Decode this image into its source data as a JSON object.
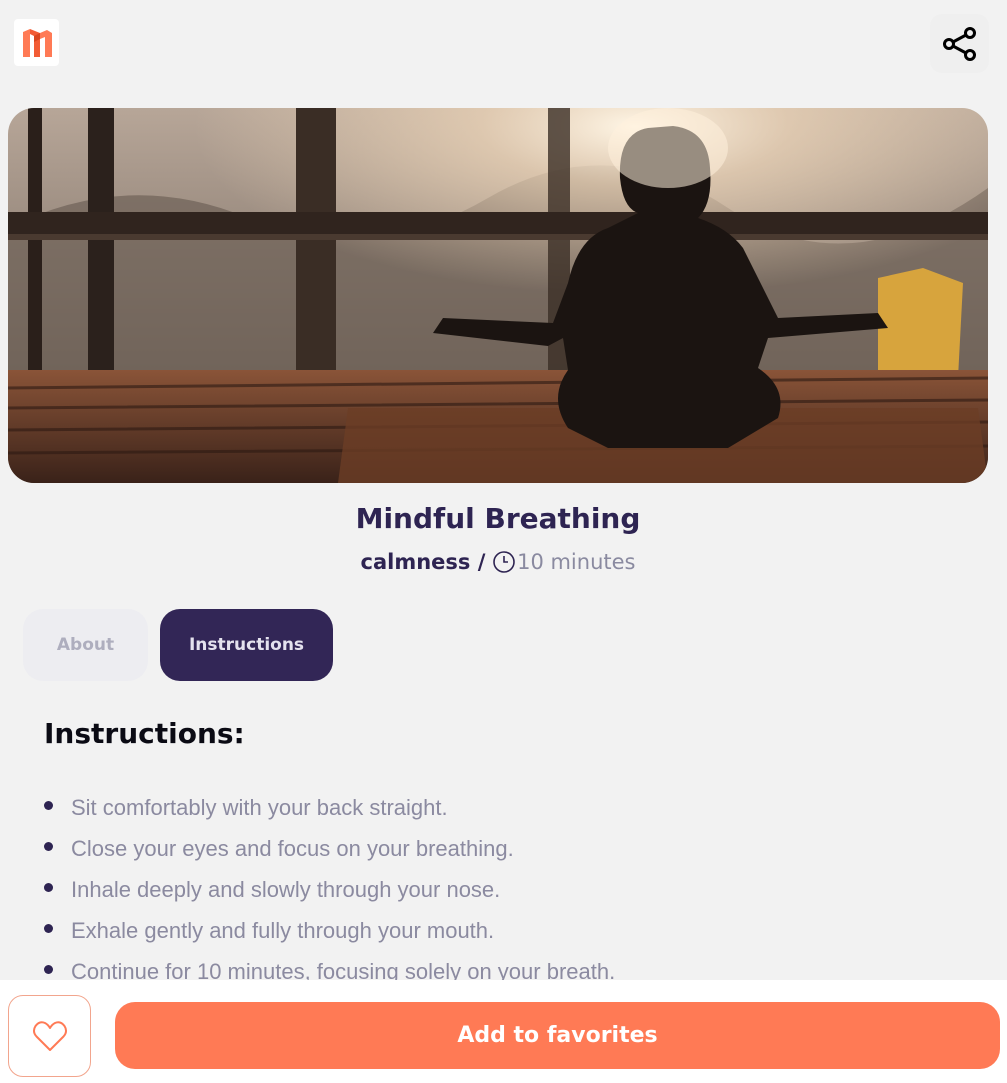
{
  "header": {
    "logo_icon": "brand-logo-icon",
    "share_icon": "share-icon"
  },
  "hero": {
    "image": "meditation-silhouette-sunset"
  },
  "exercise": {
    "title": "Mindful Breathing",
    "category": "calmness /",
    "clock_icon": "clock-icon",
    "duration": "10 minutes"
  },
  "tabs": [
    {
      "label": "About",
      "active": false
    },
    {
      "label": "Instructions",
      "active": true
    }
  ],
  "instructions": {
    "heading": "Instructions:",
    "steps": [
      "Sit comfortably with your back straight.",
      "Close your eyes and focus on your breathing.",
      "Inhale deeply and slowly through your nose.",
      "Exhale gently and fully through your mouth.",
      "Continue for 10 minutes, focusing solely on your breath."
    ]
  },
  "footer": {
    "favorite_icon": "heart-icon",
    "cta_label": "Add to favorites"
  },
  "colors": {
    "primary": "#2e2452",
    "accent": "#ff7a55",
    "muted_text": "#8b8aa0",
    "background": "#f2f2f2"
  }
}
